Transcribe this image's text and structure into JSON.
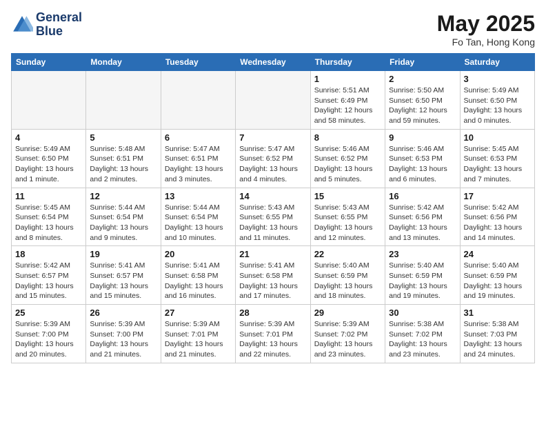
{
  "header": {
    "logo_line1": "General",
    "logo_line2": "Blue",
    "month": "May 2025",
    "location": "Fo Tan, Hong Kong"
  },
  "weekdays": [
    "Sunday",
    "Monday",
    "Tuesday",
    "Wednesday",
    "Thursday",
    "Friday",
    "Saturday"
  ],
  "weeks": [
    [
      {
        "day": "",
        "content": ""
      },
      {
        "day": "",
        "content": ""
      },
      {
        "day": "",
        "content": ""
      },
      {
        "day": "",
        "content": ""
      },
      {
        "day": "1",
        "content": "Sunrise: 5:51 AM\nSunset: 6:49 PM\nDaylight: 12 hours and 58 minutes."
      },
      {
        "day": "2",
        "content": "Sunrise: 5:50 AM\nSunset: 6:50 PM\nDaylight: 12 hours and 59 minutes."
      },
      {
        "day": "3",
        "content": "Sunrise: 5:49 AM\nSunset: 6:50 PM\nDaylight: 13 hours and 0 minutes."
      }
    ],
    [
      {
        "day": "4",
        "content": "Sunrise: 5:49 AM\nSunset: 6:50 PM\nDaylight: 13 hours and 1 minute."
      },
      {
        "day": "5",
        "content": "Sunrise: 5:48 AM\nSunset: 6:51 PM\nDaylight: 13 hours and 2 minutes."
      },
      {
        "day": "6",
        "content": "Sunrise: 5:47 AM\nSunset: 6:51 PM\nDaylight: 13 hours and 3 minutes."
      },
      {
        "day": "7",
        "content": "Sunrise: 5:47 AM\nSunset: 6:52 PM\nDaylight: 13 hours and 4 minutes."
      },
      {
        "day": "8",
        "content": "Sunrise: 5:46 AM\nSunset: 6:52 PM\nDaylight: 13 hours and 5 minutes."
      },
      {
        "day": "9",
        "content": "Sunrise: 5:46 AM\nSunset: 6:53 PM\nDaylight: 13 hours and 6 minutes."
      },
      {
        "day": "10",
        "content": "Sunrise: 5:45 AM\nSunset: 6:53 PM\nDaylight: 13 hours and 7 minutes."
      }
    ],
    [
      {
        "day": "11",
        "content": "Sunrise: 5:45 AM\nSunset: 6:54 PM\nDaylight: 13 hours and 8 minutes."
      },
      {
        "day": "12",
        "content": "Sunrise: 5:44 AM\nSunset: 6:54 PM\nDaylight: 13 hours and 9 minutes."
      },
      {
        "day": "13",
        "content": "Sunrise: 5:44 AM\nSunset: 6:54 PM\nDaylight: 13 hours and 10 minutes."
      },
      {
        "day": "14",
        "content": "Sunrise: 5:43 AM\nSunset: 6:55 PM\nDaylight: 13 hours and 11 minutes."
      },
      {
        "day": "15",
        "content": "Sunrise: 5:43 AM\nSunset: 6:55 PM\nDaylight: 13 hours and 12 minutes."
      },
      {
        "day": "16",
        "content": "Sunrise: 5:42 AM\nSunset: 6:56 PM\nDaylight: 13 hours and 13 minutes."
      },
      {
        "day": "17",
        "content": "Sunrise: 5:42 AM\nSunset: 6:56 PM\nDaylight: 13 hours and 14 minutes."
      }
    ],
    [
      {
        "day": "18",
        "content": "Sunrise: 5:42 AM\nSunset: 6:57 PM\nDaylight: 13 hours and 15 minutes."
      },
      {
        "day": "19",
        "content": "Sunrise: 5:41 AM\nSunset: 6:57 PM\nDaylight: 13 hours and 15 minutes."
      },
      {
        "day": "20",
        "content": "Sunrise: 5:41 AM\nSunset: 6:58 PM\nDaylight: 13 hours and 16 minutes."
      },
      {
        "day": "21",
        "content": "Sunrise: 5:41 AM\nSunset: 6:58 PM\nDaylight: 13 hours and 17 minutes."
      },
      {
        "day": "22",
        "content": "Sunrise: 5:40 AM\nSunset: 6:59 PM\nDaylight: 13 hours and 18 minutes."
      },
      {
        "day": "23",
        "content": "Sunrise: 5:40 AM\nSunset: 6:59 PM\nDaylight: 13 hours and 19 minutes."
      },
      {
        "day": "24",
        "content": "Sunrise: 5:40 AM\nSunset: 6:59 PM\nDaylight: 13 hours and 19 minutes."
      }
    ],
    [
      {
        "day": "25",
        "content": "Sunrise: 5:39 AM\nSunset: 7:00 PM\nDaylight: 13 hours and 20 minutes."
      },
      {
        "day": "26",
        "content": "Sunrise: 5:39 AM\nSunset: 7:00 PM\nDaylight: 13 hours and 21 minutes."
      },
      {
        "day": "27",
        "content": "Sunrise: 5:39 AM\nSunset: 7:01 PM\nDaylight: 13 hours and 21 minutes."
      },
      {
        "day": "28",
        "content": "Sunrise: 5:39 AM\nSunset: 7:01 PM\nDaylight: 13 hours and 22 minutes."
      },
      {
        "day": "29",
        "content": "Sunrise: 5:39 AM\nSunset: 7:02 PM\nDaylight: 13 hours and 23 minutes."
      },
      {
        "day": "30",
        "content": "Sunrise: 5:38 AM\nSunset: 7:02 PM\nDaylight: 13 hours and 23 minutes."
      },
      {
        "day": "31",
        "content": "Sunrise: 5:38 AM\nSunset: 7:03 PM\nDaylight: 13 hours and 24 minutes."
      }
    ]
  ]
}
